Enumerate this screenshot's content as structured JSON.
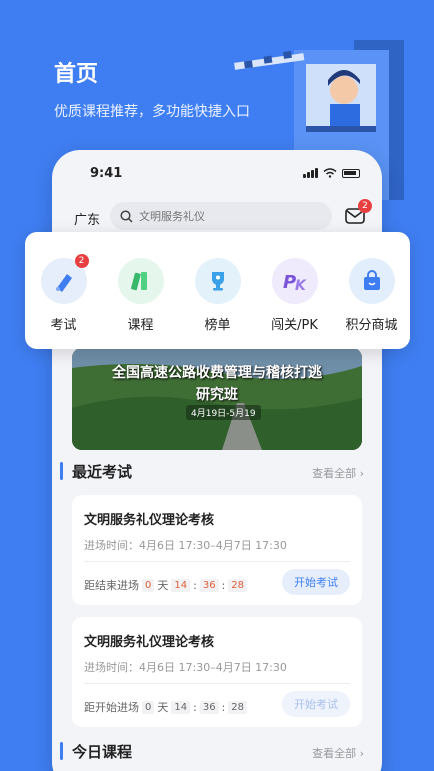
{
  "hero": {
    "title": "首页",
    "subtitle": "优质课程推荐，多功能快捷入口"
  },
  "status_bar": {
    "time": "9:41"
  },
  "top_bar": {
    "region": "广东",
    "search_placeholder": "文明服务礼仪",
    "mail_badge": "2"
  },
  "quick_menu": [
    {
      "label": "考试",
      "icon": "exam-pen-icon",
      "badge": "2",
      "bg": "#e6edfb"
    },
    {
      "label": "课程",
      "icon": "course-books-icon",
      "badge": "",
      "bg": "#e5f6ec"
    },
    {
      "label": "榜单",
      "icon": "trophy-icon",
      "badge": "",
      "bg": "#e3f1fb"
    },
    {
      "label": "闯关/PK",
      "icon": "pk-icon",
      "badge": "",
      "bg": "#efeafc"
    },
    {
      "label": "积分商城",
      "icon": "shopping-bag-icon",
      "badge": "",
      "bg": "#e3eefc"
    }
  ],
  "banner": {
    "line1": "全国高速公路收费管理与稽核打逃",
    "line2": "研究班",
    "dates": "4月19日-5月19"
  },
  "recent_exams": {
    "title": "最近考试",
    "more": "查看全部",
    "items": [
      {
        "title": "文明服务礼仪理论考核",
        "time": "进场时间：4月6日 17:30–4月7日 17:30",
        "count_label": "距结束进场",
        "days": "0",
        "day_unit": "天",
        "h": "14",
        "m": "36",
        "s": "28",
        "button": "开始考试"
      },
      {
        "title": "文明服务礼仪理论考核",
        "time": "进场时间：4月6日 17:30–4月7日 17:30",
        "count_label": "距开始进场",
        "days": "0",
        "day_unit": "天",
        "h": "14",
        "m": "36",
        "s": "28",
        "button": "开始考试"
      }
    ]
  },
  "today_courses": {
    "title": "今日课程",
    "more": "查看全部"
  },
  "colors": {
    "primary": "#3f7ef2",
    "badge": "#e84040",
    "countdown": "#e0603a"
  }
}
